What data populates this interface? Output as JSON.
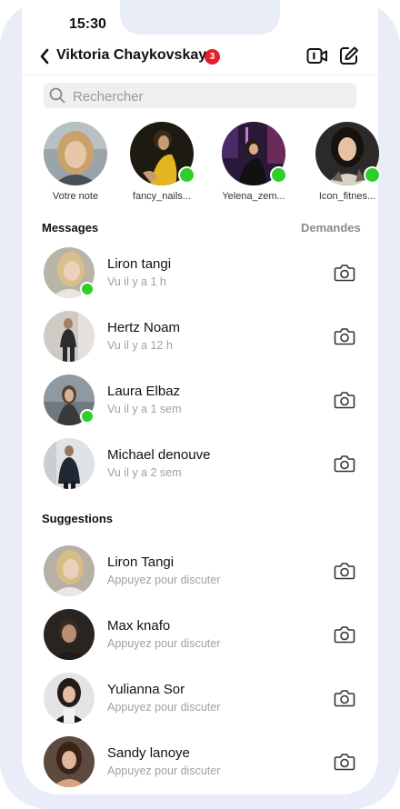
{
  "status_bar": {
    "time": "15:30"
  },
  "header": {
    "title": "Viktoria Chaykovskaya",
    "badge_count": "3"
  },
  "search": {
    "placeholder": "Rechercher"
  },
  "stories": [
    {
      "label": "Votre note",
      "online": false
    },
    {
      "label": "fancy_nails...",
      "online": true
    },
    {
      "label": "Yelena_zem...",
      "online": true
    },
    {
      "label": "Icon_fitnes...",
      "online": true
    }
  ],
  "messages": {
    "title": "Messages",
    "requests_label": "Demandes",
    "items": [
      {
        "name": "Liron tangi",
        "status": "Vu il y a 1 h",
        "online": true
      },
      {
        "name": "Hertz Noam",
        "status": "Vu il y a 12 h",
        "online": false
      },
      {
        "name": "Laura Elbaz",
        "status": "Vu il y a 1 sem",
        "online": true
      },
      {
        "name": "Michael denouve",
        "status": "Vu il y a 2 sem",
        "online": false
      }
    ]
  },
  "suggestions": {
    "title": "Suggestions",
    "items": [
      {
        "name": "Liron Tangi",
        "status": "Appuyez pour discuter"
      },
      {
        "name": "Max knafo",
        "status": "Appuyez pour discuter"
      },
      {
        "name": "Yulianna Sor",
        "status": "Appuyez pour discuter"
      },
      {
        "name": "Sandy lanoye",
        "status": "Appuyez pour discuter"
      }
    ]
  },
  "colors": {
    "online": "#2fce2b",
    "badge": "#e41e2b",
    "frame": "#e8edf8",
    "secondary_text": "#a0a0a0"
  }
}
